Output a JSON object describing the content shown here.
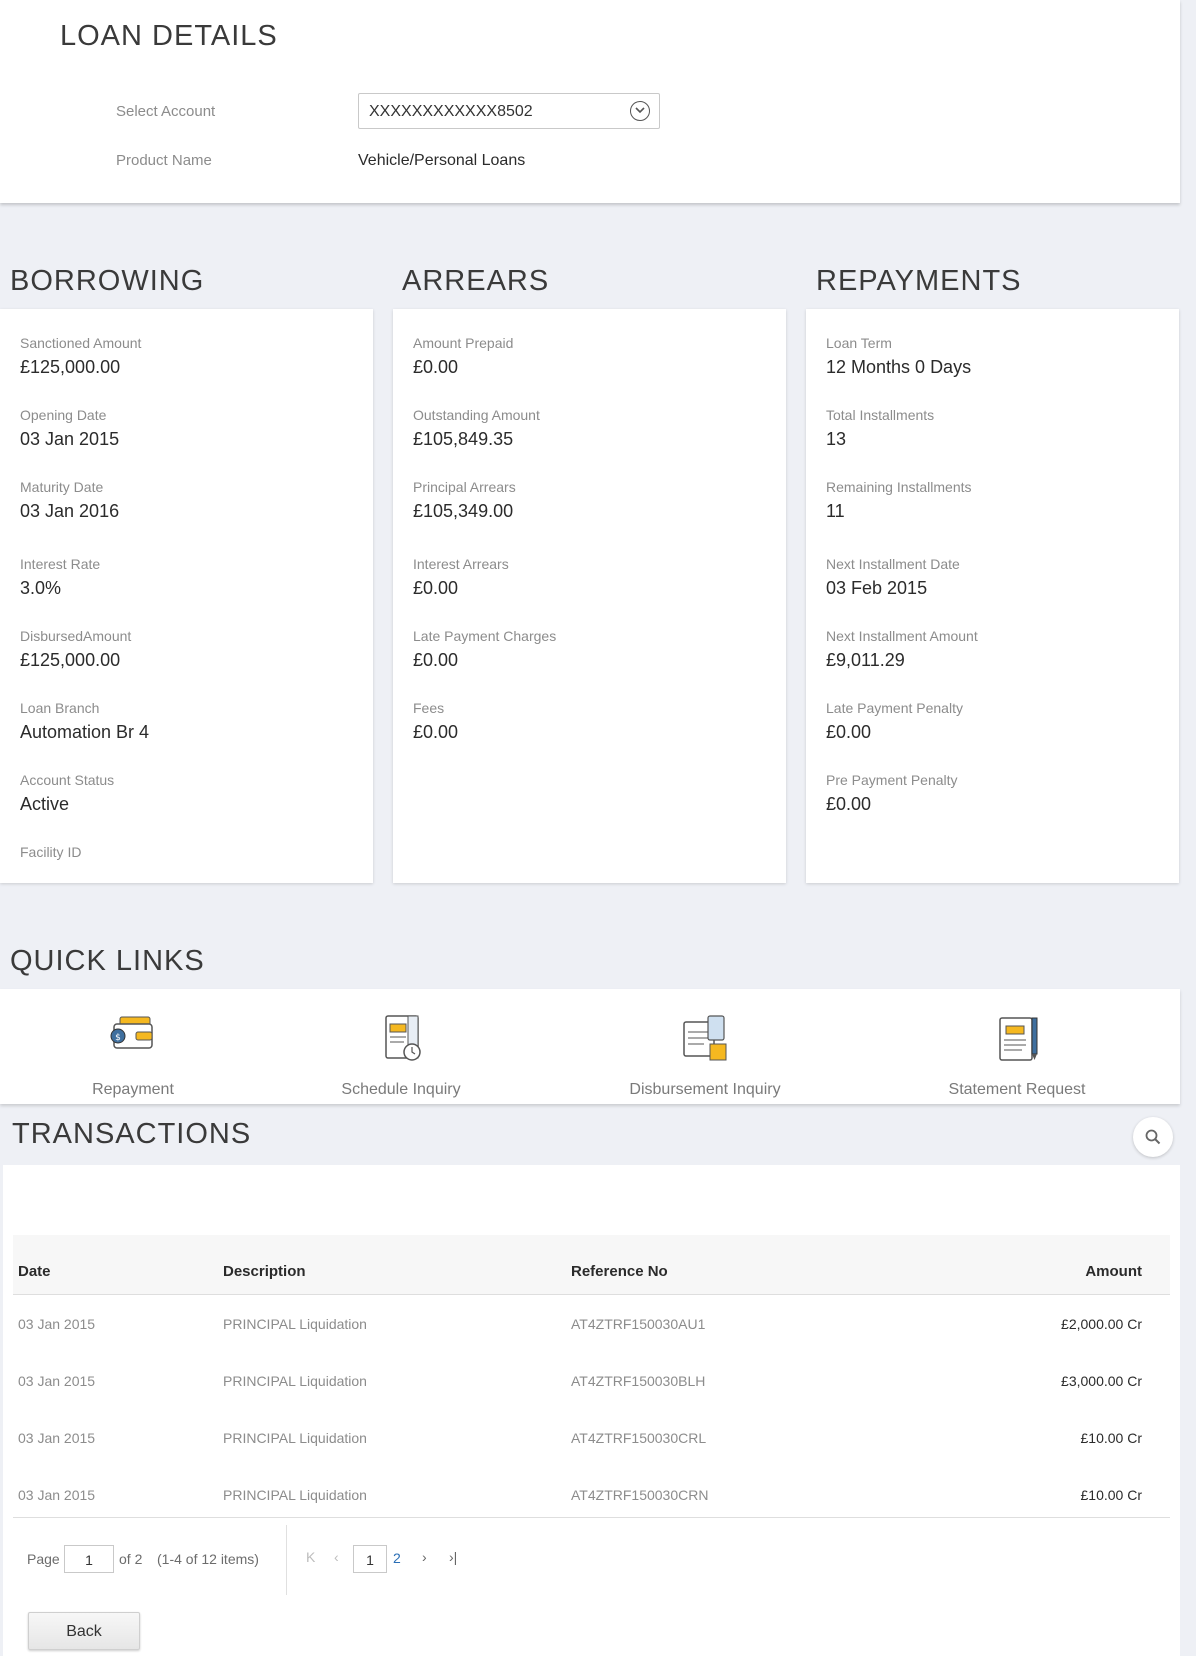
{
  "loan_details": {
    "title": "LOAN DETAILS",
    "select_account_label": "Select Account",
    "select_account_value": "XXXXXXXXXXXX8502",
    "product_name_label": "Product Name",
    "product_name_value": "Vehicle/Personal Loans"
  },
  "borrowing": {
    "title": "BORROWING",
    "fields": [
      {
        "label": "Sanctioned Amount",
        "value": "£125,000.00"
      },
      {
        "label": "Opening Date",
        "value": "03 Jan 2015"
      },
      {
        "label": "Maturity Date",
        "value": "03 Jan 2016"
      },
      {
        "label": "Interest Rate",
        "value": "3.0%"
      },
      {
        "label": "DisbursedAmount",
        "value": "£125,000.00"
      },
      {
        "label": "Loan Branch",
        "value": "Automation Br 4"
      },
      {
        "label": "Account Status",
        "value": "Active"
      },
      {
        "label": "Facility ID",
        "value": ""
      }
    ]
  },
  "arrears": {
    "title": "ARREARS",
    "fields": [
      {
        "label": "Amount Prepaid",
        "value": "£0.00"
      },
      {
        "label": "Outstanding Amount",
        "value": "£105,849.35"
      },
      {
        "label": "Principal Arrears",
        "value": "£105,349.00"
      },
      {
        "label": "Interest Arrears",
        "value": "£0.00"
      },
      {
        "label": "Late Payment Charges",
        "value": "£0.00"
      },
      {
        "label": "Fees",
        "value": "£0.00"
      }
    ]
  },
  "repayments": {
    "title": "REPAYMENTS",
    "fields": [
      {
        "label": "Loan Term",
        "value": "12 Months 0 Days"
      },
      {
        "label": "Total Installments",
        "value": "13"
      },
      {
        "label": "Remaining Installments",
        "value": "11"
      },
      {
        "label": "Next Installment Date",
        "value": "03 Feb 2015"
      },
      {
        "label": "Next Installment Amount",
        "value": "£9,011.29"
      },
      {
        "label": "Late Payment Penalty",
        "value": "£0.00"
      },
      {
        "label": "Pre Payment Penalty",
        "value": "£0.00"
      }
    ]
  },
  "quick_links": {
    "title": "QUICK LINKS",
    "items": [
      {
        "label": "Repayment",
        "icon": "wallet-icon"
      },
      {
        "label": "Schedule Inquiry",
        "icon": "schedule-icon"
      },
      {
        "label": "Disbursement Inquiry",
        "icon": "disbursement-icon"
      },
      {
        "label": "Statement Request",
        "icon": "statement-icon"
      }
    ]
  },
  "transactions": {
    "title": "TRANSACTIONS",
    "columns": [
      "Date",
      "Description",
      "Reference No",
      "Amount"
    ],
    "rows": [
      {
        "date": "03 Jan 2015",
        "description": "PRINCIPAL Liquidation",
        "reference": "AT4ZTRF150030AU1",
        "amount": "£2,000.00 Cr"
      },
      {
        "date": "03 Jan 2015",
        "description": "PRINCIPAL Liquidation",
        "reference": "AT4ZTRF150030BLH",
        "amount": "£3,000.00 Cr"
      },
      {
        "date": "03 Jan 2015",
        "description": "PRINCIPAL Liquidation",
        "reference": "AT4ZTRF150030CRL",
        "amount": "£10.00 Cr"
      },
      {
        "date": "03 Jan 2015",
        "description": "PRINCIPAL Liquidation",
        "reference": "AT4ZTRF150030CRN",
        "amount": "£10.00 Cr"
      }
    ],
    "pager": {
      "page_label": "Page",
      "current_page": "1",
      "of_label": "of 2",
      "range_label": "(1-4  of 12 items)",
      "first_glyph": "K",
      "prev_glyph": "‹",
      "next_glyph": "›",
      "last_glyph": "›|",
      "page_1": "1",
      "page_2": "2"
    }
  },
  "back_label": "Back",
  "colors": {
    "background": "#eef0f5",
    "accent_yellow": "#f5b820",
    "link_blue": "#2a6eb5"
  }
}
